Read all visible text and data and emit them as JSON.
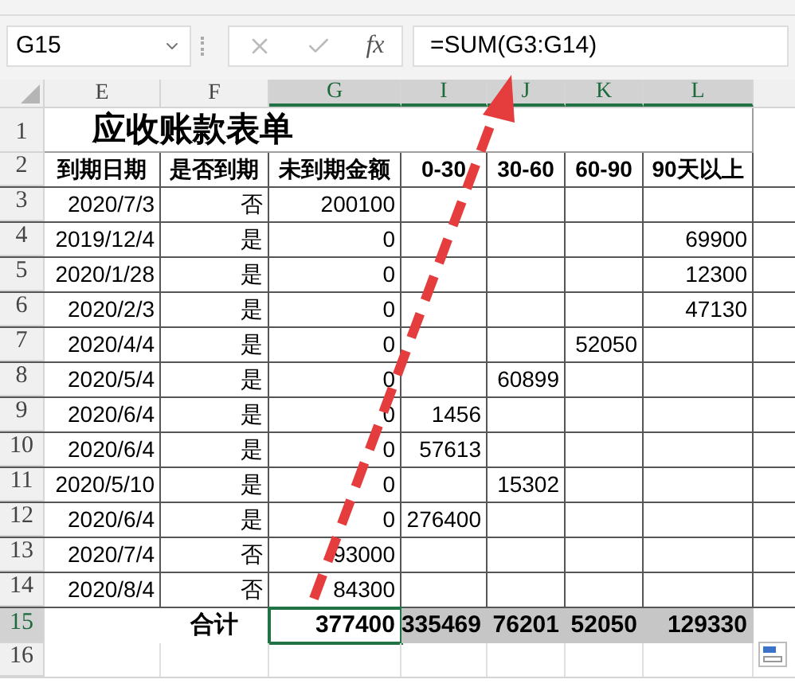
{
  "name_box": "G15",
  "fx": "fx",
  "formula": "=SUM(G3:G14)",
  "columns": [
    {
      "label": "E",
      "selected": false
    },
    {
      "label": "F",
      "selected": false
    },
    {
      "label": "G",
      "selected": true
    },
    {
      "label": "I",
      "selected": true
    },
    {
      "label": "J",
      "selected": true
    },
    {
      "label": "K",
      "selected": true
    },
    {
      "label": "L",
      "selected": true
    }
  ],
  "rows": [
    {
      "number": "1",
      "kind": "title",
      "selected": false,
      "title": "应收账款表单"
    },
    {
      "number": "2",
      "kind": "header",
      "selected": false,
      "cells": [
        "到期日期",
        "是否到期",
        "未到期金额",
        "0-30",
        "30-60",
        "60-90",
        "90天以上"
      ]
    },
    {
      "number": "3",
      "kind": "data",
      "selected": false,
      "cells": [
        "2020/7/3",
        "否",
        "200100",
        null,
        null,
        null,
        null
      ]
    },
    {
      "number": "4",
      "kind": "data",
      "selected": false,
      "cells": [
        "2019/12/4",
        "是",
        "0",
        null,
        null,
        null,
        "69900"
      ]
    },
    {
      "number": "5",
      "kind": "data",
      "selected": false,
      "cells": [
        "2020/1/28",
        "是",
        "0",
        null,
        null,
        null,
        "12300"
      ]
    },
    {
      "number": "6",
      "kind": "data",
      "selected": false,
      "cells": [
        "2020/2/3",
        "是",
        "0",
        null,
        null,
        null,
        "47130"
      ]
    },
    {
      "number": "7",
      "kind": "data",
      "selected": false,
      "cells": [
        "2020/4/4",
        "是",
        "0",
        null,
        null,
        "52050",
        null
      ]
    },
    {
      "number": "8",
      "kind": "data",
      "selected": false,
      "cells": [
        "2020/5/4",
        "是",
        "0",
        null,
        "60899",
        null,
        null
      ]
    },
    {
      "number": "9",
      "kind": "data",
      "selected": false,
      "cells": [
        "2020/6/4",
        "是",
        "0",
        "1456",
        null,
        null,
        null
      ]
    },
    {
      "number": "10",
      "kind": "data",
      "selected": false,
      "cells": [
        "2020/6/4",
        "是",
        "0",
        "57613",
        null,
        null,
        null
      ]
    },
    {
      "number": "11",
      "kind": "data",
      "selected": false,
      "cells": [
        "2020/5/10",
        "是",
        "0",
        null,
        "15302",
        null,
        null
      ]
    },
    {
      "number": "12",
      "kind": "data",
      "selected": false,
      "cells": [
        "2020/6/4",
        "是",
        "0",
        "276400",
        null,
        null,
        null
      ]
    },
    {
      "number": "13",
      "kind": "data",
      "selected": false,
      "cells": [
        "2020/7/4",
        "否",
        "93000",
        null,
        null,
        null,
        null
      ]
    },
    {
      "number": "14",
      "kind": "data",
      "selected": false,
      "cells": [
        "2020/8/4",
        "否",
        "84300",
        null,
        null,
        null,
        null
      ]
    },
    {
      "number": "15",
      "kind": "total",
      "selected": true,
      "cells": [
        {
          "text": null,
          "selected": false
        },
        {
          "text": "合计",
          "selected": false
        },
        {
          "text": "377400",
          "selected": false
        },
        {
          "text": "335469",
          "selected": true
        },
        {
          "text": "76201",
          "selected": true
        },
        {
          "text": "52050",
          "selected": true
        },
        {
          "text": "129330",
          "selected": true
        }
      ]
    },
    {
      "number": "16",
      "kind": "empty",
      "selected": false
    }
  ]
}
